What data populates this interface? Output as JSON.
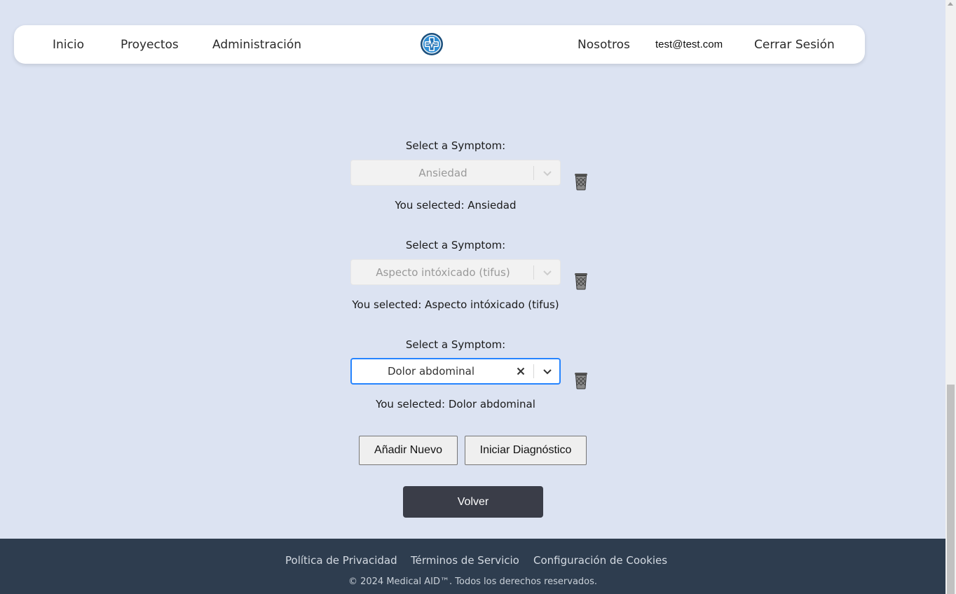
{
  "nav": {
    "inicio": "Inicio",
    "proyectos": "Proyectos",
    "administracion": "Administración",
    "nosotros": "Nosotros",
    "email": "test@test.com",
    "cerrar_sesion": "Cerrar Sesión"
  },
  "symptoms": [
    {
      "label": "Select a Symptom:",
      "value": "Ansiedad",
      "state": "disabled",
      "selected_text": "You selected: Ansiedad"
    },
    {
      "label": "Select a Symptom:",
      "value": "Aspecto intóxicado (tifus)",
      "state": "disabled",
      "selected_text": "You selected: Aspecto intóxicado (tifus)"
    },
    {
      "label": "Select a Symptom:",
      "value": "Dolor abdominal",
      "state": "active",
      "selected_text": "You selected: Dolor abdominal"
    }
  ],
  "actions": {
    "add_new": "Añadir Nuevo",
    "start_diagnosis": "Iniciar Diagnóstico",
    "back": "Volver"
  },
  "footer": {
    "privacy": "Política de Privacidad",
    "terms": "Términos de Servicio",
    "cookies": "Configuración de Cookies",
    "copyright": "© 2024 Medical AID™. Todos los derechos reservados."
  },
  "colors": {
    "page_bg": "#dce3f2",
    "footer_bg": "#2e3d4f",
    "focus_border": "#2684ff",
    "back_button": "#3a3d48"
  },
  "icons": {
    "logo": "medical-cross-logo-icon",
    "chevron": "chevron-down-icon",
    "clear": "close-icon",
    "delete": "trash-icon"
  }
}
